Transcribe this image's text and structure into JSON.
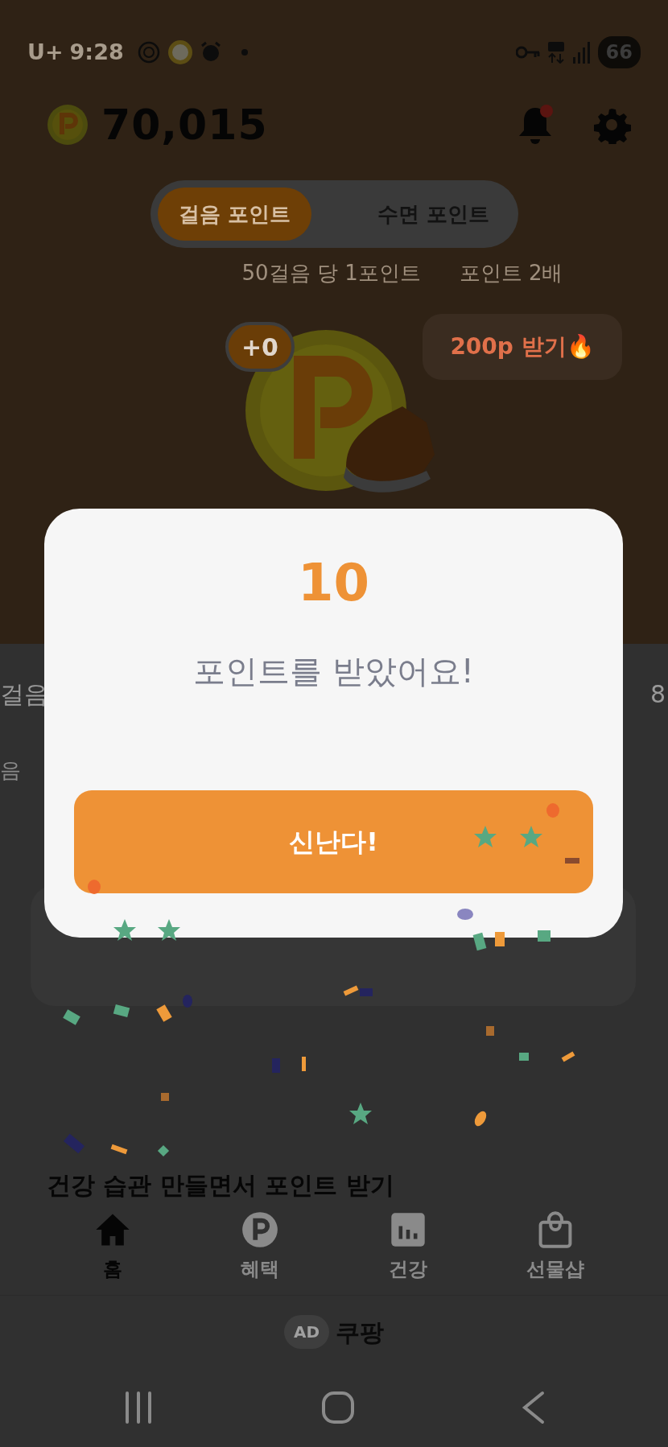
{
  "status_bar": {
    "carrier": "U+",
    "time": "9:28",
    "battery": "66"
  },
  "header": {
    "points": "70,015",
    "notification_dot": true
  },
  "mode_tabs": [
    {
      "label": "걸음 포인트",
      "selected": true
    },
    {
      "label": "수면 포인트",
      "selected": false
    }
  ],
  "rates": [
    "50걸음 당 1포인트",
    "포인트 2배"
  ],
  "gain_badge": "+0",
  "bonus_button": "200p 받기🔥",
  "behind": {
    "left_label": "걸음",
    "left_sub": "음",
    "right_label": "8",
    "section_title": "건강 습관 만들면서 포인트 받기"
  },
  "dialog": {
    "amount": "10",
    "message": "포인트를 받았어요!",
    "button": "신난다!"
  },
  "bottom_nav": [
    {
      "label": "홈",
      "kind": "home",
      "selected": true
    },
    {
      "label": "혜택",
      "kind": "coin",
      "selected": false
    },
    {
      "label": "건강",
      "kind": "chart",
      "selected": false
    },
    {
      "label": "선물샵",
      "kind": "bag",
      "selected": false
    }
  ],
  "ad": {
    "badge": "AD",
    "label": "쿠팡"
  }
}
